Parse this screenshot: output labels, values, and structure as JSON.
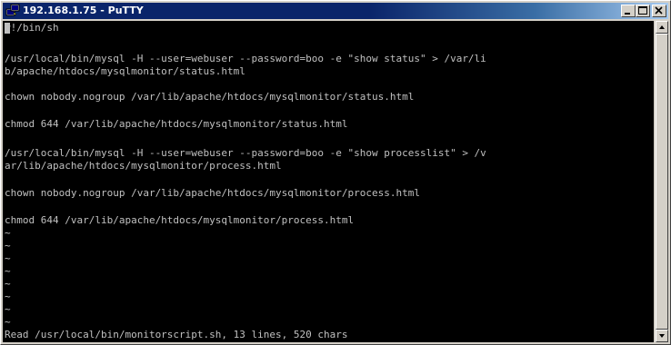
{
  "window": {
    "title": "192.168.1.75 - PuTTY",
    "icon": "putty-icon",
    "controls": [
      "minimize-icon",
      "maximize-icon",
      "close-icon"
    ],
    "title_color": "#0a246a"
  },
  "terminal": {
    "background": "#000000",
    "foreground": "#c0c0c0",
    "lines": [
      "#!/bin/sh",
      "",
      "/usr/local/bin/mysql -H --user=webuser --password=boo -e \"show status\" > /var/li",
      "b/apache/htdocs/mysqlmonitor/status.html",
      "",
      "chown nobody.nogroup /var/lib/apache/htdocs/mysqlmonitor/status.html",
      "",
      "chmod 644 /var/lib/apache/htdocs/mysqlmonitor/status.html",
      "",
      "/usr/local/bin/mysql -H --user=webuser --password=boo -e \"show processlist\" > /v",
      "ar/lib/apache/htdocs/mysqlmonitor/process.html",
      "",
      "chown nobody.nogroup /var/lib/apache/htdocs/mysqlmonitor/process.html",
      "",
      "chmod 644 /var/lib/apache/htdocs/mysqlmonitor/process.html",
      "~",
      "~",
      "~",
      "~",
      "~",
      "~",
      "~",
      "~",
      "~",
      "Read /usr/local/bin/monitorscript.sh, 13 lines, 520 chars"
    ]
  },
  "scrollbar": {
    "up_icon": "arrow-up-icon",
    "down_icon": "arrow-down-icon"
  }
}
